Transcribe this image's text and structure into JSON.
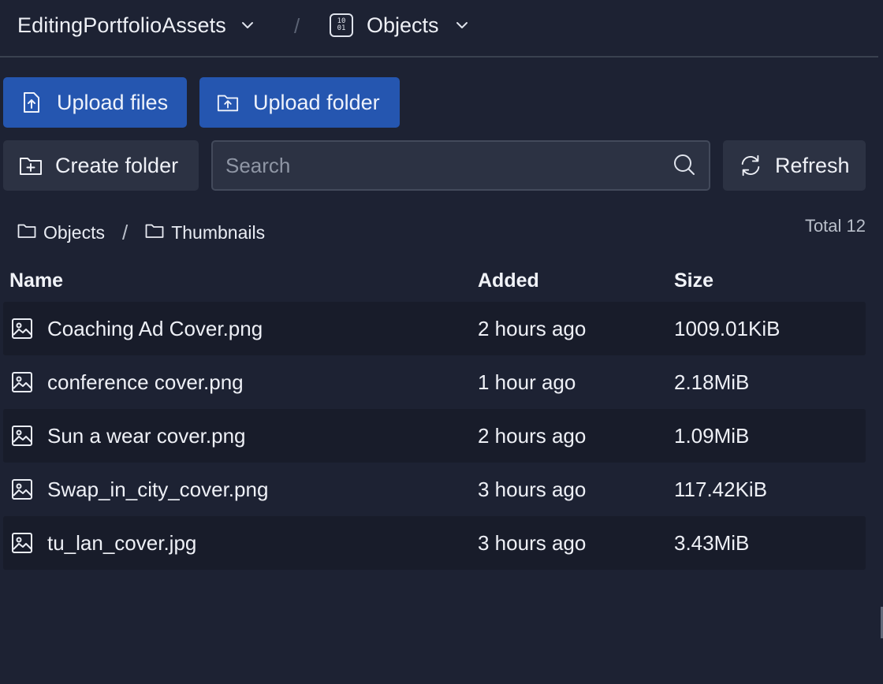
{
  "header": {
    "bucket_name": "EditingPortfolioAssets",
    "separator": "/",
    "section_name": "Objects",
    "section_icon_text": "10\n01"
  },
  "toolbar": {
    "upload_files_label": "Upload files",
    "upload_folder_label": "Upload folder",
    "create_folder_label": "Create folder",
    "refresh_label": "Refresh"
  },
  "search": {
    "placeholder": "Search",
    "value": ""
  },
  "breadcrumb": {
    "items": [
      {
        "label": "Objects"
      },
      {
        "label": "Thumbnails"
      }
    ],
    "separator": "/"
  },
  "total_label": "Total 12",
  "table": {
    "columns": [
      "Name",
      "Added",
      "Size"
    ],
    "rows": [
      {
        "name": "Coaching Ad Cover.png",
        "added": "2 hours ago",
        "size": "1009.01KiB"
      },
      {
        "name": "conference cover.png",
        "added": "1 hour ago",
        "size": "2.18MiB"
      },
      {
        "name": "Sun a wear cover.png",
        "added": "2 hours ago",
        "size": "1.09MiB"
      },
      {
        "name": "Swap_in_city_cover.png",
        "added": "3 hours ago",
        "size": "117.42KiB"
      },
      {
        "name": "tu_lan_cover.jpg",
        "added": "3 hours ago",
        "size": "3.43MiB"
      }
    ]
  },
  "colors": {
    "background": "#1d2233",
    "primary_button": "#2556b0",
    "secondary_button": "#2c3243",
    "row_alt": "#181c2a"
  },
  "icons": {
    "file_row": "image-file-icon",
    "upload_files": "upload-file-icon",
    "upload_folder": "upload-folder-icon",
    "create_folder": "folder-plus-icon",
    "refresh": "refresh-icon",
    "search": "search-icon"
  }
}
